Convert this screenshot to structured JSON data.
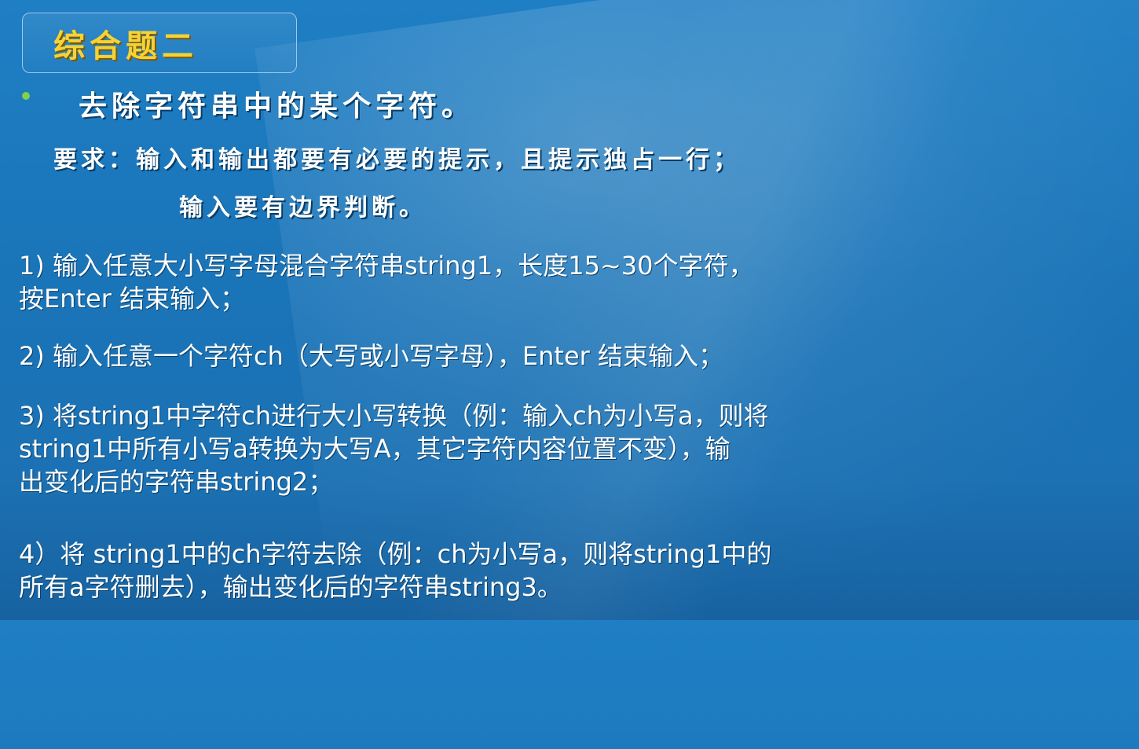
{
  "title": "综合题二",
  "heading": "去除字符串中的某个字符。",
  "requirements": {
    "line1": "要求：输入和输出都要有必要的提示，且提示独占一行；",
    "line2": "输入要有边界判断。"
  },
  "items": [
    {
      "lines": [
        "1) 输入任意大小写字母混合字符串string1，长度15~30个字符，",
        "按Enter 结束输入；"
      ]
    },
    {
      "lines": [
        "2) 输入任意一个字符ch（大写或小写字母），Enter 结束输入；"
      ]
    },
    {
      "lines": [
        "3) 将string1中字符ch进行大小写转换（例：输入ch为小写a，则将",
        "string1中所有小写a转换为大写A，其它字符内容位置不变），输",
        "出变化后的字符串string2；"
      ]
    },
    {
      "lines": [
        "4）将 string1中的ch字符去除（例：ch为小写a，则将string1中的",
        "所有a字符删去），输出变化后的字符串string3。"
      ]
    }
  ],
  "colors": {
    "background": "#1f7fc4",
    "title_text": "#f4d23a",
    "bullet": "#7fd04a",
    "body_text": "#ffffff"
  }
}
